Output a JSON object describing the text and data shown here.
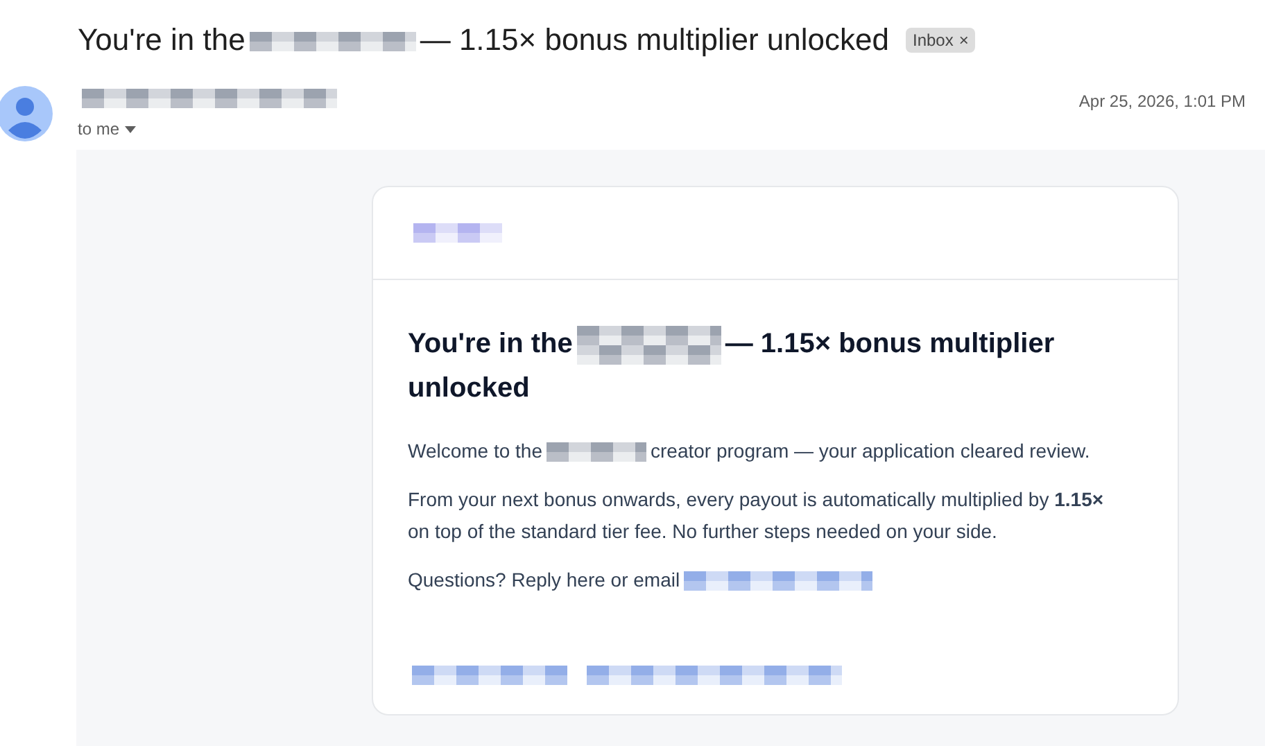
{
  "subject": {
    "parts": [
      {
        "kind": "text",
        "text": "You're in the"
      },
      {
        "kind": "redacted",
        "color": "#9ca3af"
      },
      {
        "kind": "text",
        "text": "— 1.15× bonus multiplier unlocked"
      }
    ],
    "label": "Inbox",
    "label_close": "×"
  },
  "sender": {
    "name": {
      "kind": "redacted",
      "color": "#9ca3af"
    },
    "recipient": "to me",
    "date": "Apr 25, 2026, 1:01 PM"
  },
  "email": {
    "logo": {
      "kind": "redacted",
      "color": "#b4b4f0"
    },
    "heading": [
      [
        {
          "kind": "text",
          "text": "You're in the"
        },
        {
          "kind": "redacted",
          "color": "#9ca3af"
        },
        {
          "kind": "text",
          "text": "— 1.15× bonus multiplier"
        }
      ],
      [
        {
          "kind": "text",
          "text": "unlocked"
        }
      ]
    ],
    "paragraphs": [
      [
        {
          "kind": "text",
          "text": "Welcome to the"
        },
        {
          "kind": "redacted",
          "color": "#9ca3af"
        },
        {
          "kind": "text",
          "text": "creator program — your application cleared review."
        }
      ],
      [
        {
          "kind": "text",
          "text": "From your next bonus onwards, every payout is automatically multiplied by **1.15×** on top of the standard tier fee. No further steps needed on your side."
        }
      ],
      [
        {
          "kind": "text",
          "text": "Questions? Reply here or email"
        },
        {
          "kind": "redacted",
          "color": "#93aee8"
        }
      ]
    ],
    "footer": [
      {
        "color": "#93aee8"
      },
      {
        "color": "#93aee8"
      }
    ]
  }
}
